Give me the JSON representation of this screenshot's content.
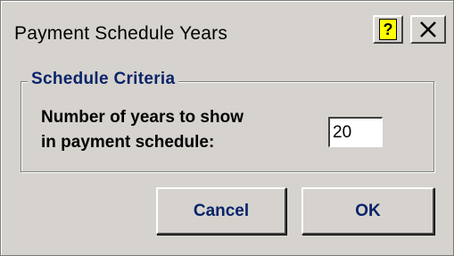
{
  "window": {
    "title": "Payment Schedule Years",
    "help_icon": "help-question-icon",
    "close_icon": "close-x-icon"
  },
  "group": {
    "title": "Schedule Criteria",
    "field_label_line1": "Number of years to show",
    "field_label_line2": "in payment schedule:",
    "years_value": "20"
  },
  "buttons": {
    "cancel_label": "Cancel",
    "ok_label": "OK"
  },
  "colors": {
    "dialog_bg": "#d6d3ce",
    "accent_text": "#0a246a",
    "help_icon_bg": "#ffff00"
  }
}
